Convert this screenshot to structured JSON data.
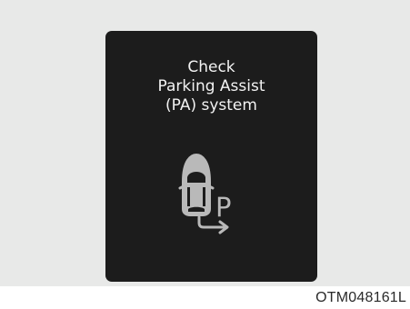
{
  "message": {
    "line1": "Check",
    "line2": "Parking Assist",
    "line3": "(PA) system"
  },
  "icon": {
    "name": "parking-assist-warning-icon",
    "letter": "P"
  },
  "figure_code": "OTM048161L",
  "colors": {
    "page_background": "#e8e9e8",
    "panel_background": "#1c1c1c",
    "icon_color": "#b9b9b9",
    "text_color": "#f2f2f2"
  }
}
